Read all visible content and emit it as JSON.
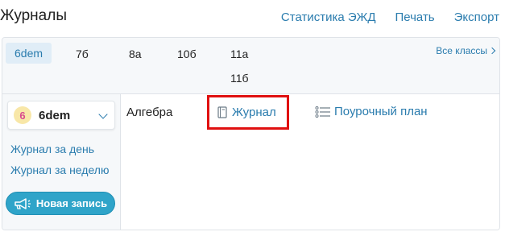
{
  "header": {
    "title": "Журналы",
    "links": [
      "Статистика ЭЖД",
      "Печать",
      "Экспорт"
    ]
  },
  "classes": {
    "items": [
      "6dem",
      "7б",
      "8а",
      "10б",
      "11а",
      "11б"
    ],
    "active": "6dem",
    "all_classes": "Все классы"
  },
  "sidebar": {
    "selected_class": "6dem",
    "badge_text": "6",
    "links": [
      "Журнал за день",
      "Журнал за неделю"
    ],
    "new_entry_button": "Новая запись"
  },
  "main": {
    "subject": "Алгебра",
    "journal_link": "Журнал",
    "plan_link": "Поурочный план"
  },
  "colors": {
    "link": "#2a7cae",
    "button": "#2fa4c9",
    "highlight": "#e01010"
  }
}
